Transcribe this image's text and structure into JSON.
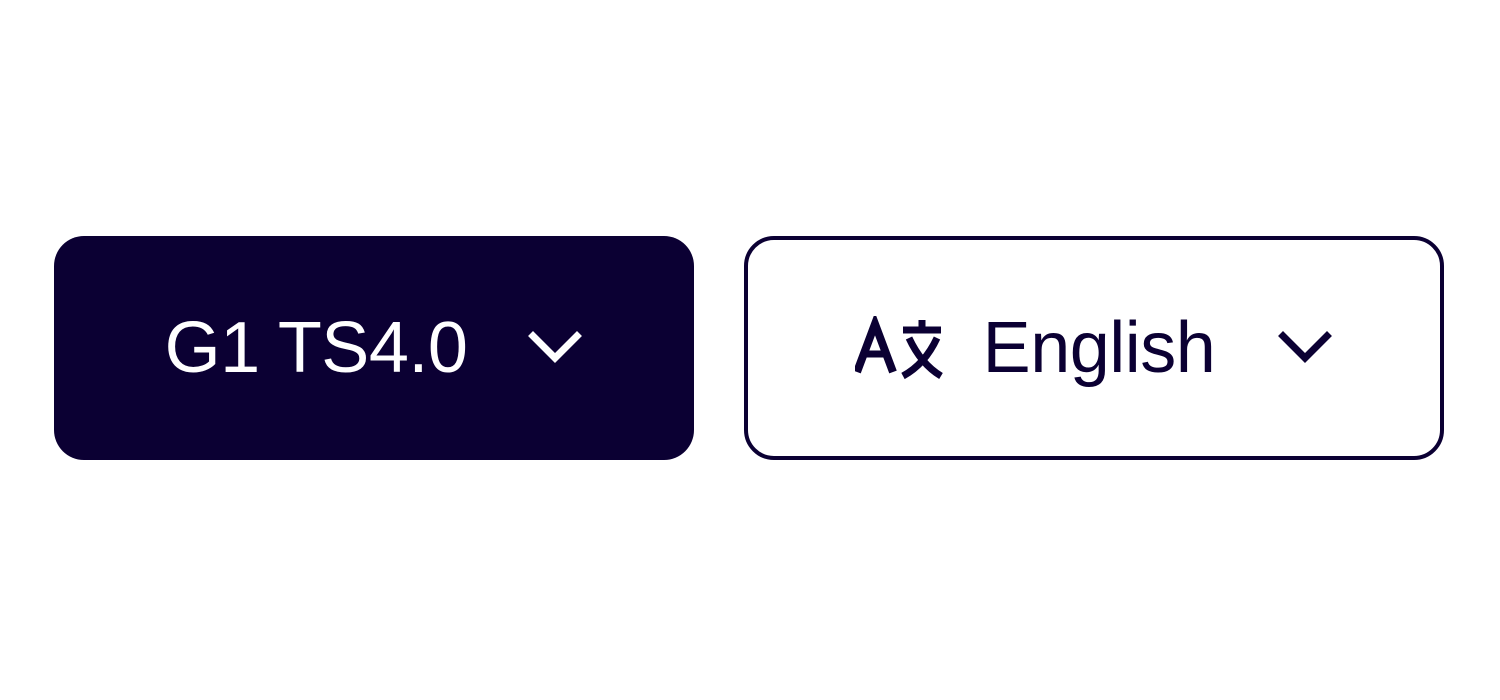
{
  "version_selector": {
    "label": "G1 TS4.0",
    "icon": "chevron-down-icon"
  },
  "language_selector": {
    "label": "English",
    "leading_icon": "translate-icon",
    "trailing_icon": "chevron-down-icon"
  },
  "colors": {
    "primary": "#0b0033",
    "background": "#ffffff"
  }
}
